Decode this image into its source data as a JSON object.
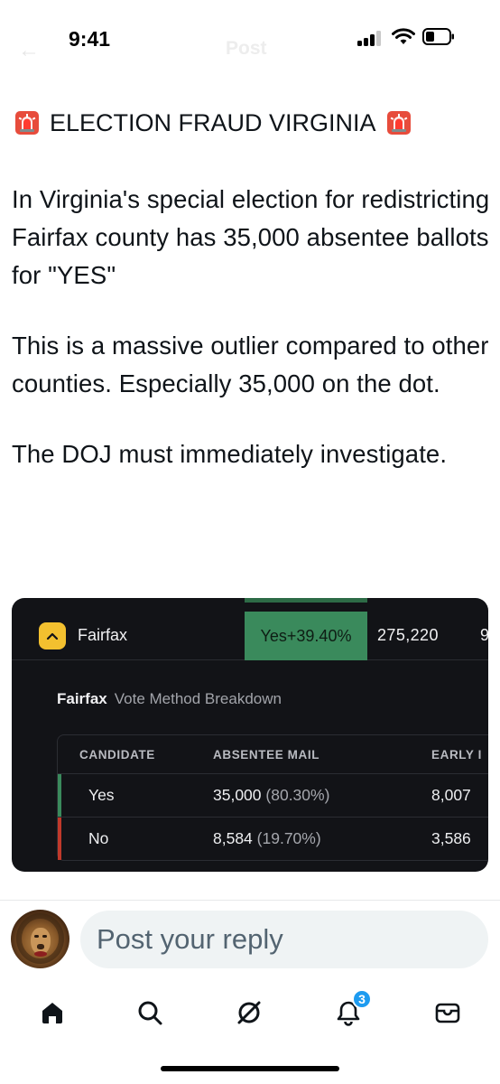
{
  "status_bar": {
    "time": "9:41",
    "ghost_title": "Post",
    "icons": [
      "back-arrow-icon",
      "cellular-signal-icon",
      "wifi-icon",
      "battery-icon"
    ]
  },
  "post": {
    "title": "ELECTION FRAUD VIRGINIA",
    "title_icon": "police-siren-emoji",
    "paragraphs": [
      "In Virginia's special election for redistricting Fairfax county has 35,000 absentee ballots for \"YES\"",
      "This is a massive outlier compared to other counties. Especially  35,000 on the dot.",
      "The DOJ must immediately investigate."
    ]
  },
  "embed": {
    "county_row": {
      "county": "Fairfax",
      "result": "Yes+39.40%",
      "total": "275,220",
      "total_cut": "9",
      "expand_icon": "chevron-up-icon"
    },
    "breakdown": {
      "county": "Fairfax",
      "label": "Vote Method Breakdown"
    },
    "table": {
      "headers": [
        "CANDIDATE",
        "ABSENTEE MAIL",
        "EARLY I"
      ],
      "rows": [
        {
          "candidate": "Yes",
          "absentee": "35,000",
          "absentee_pct": "(80.30%)",
          "early": "8,007",
          "color": "#3a8a5c"
        },
        {
          "candidate": "No",
          "absentee": "8,584",
          "absentee_pct": "(19.70%)",
          "early": "3,586",
          "color": "#c0392b"
        }
      ]
    }
  },
  "reply": {
    "placeholder": "Post your reply",
    "avatar": "lion-avatar"
  },
  "nav": {
    "items": [
      "home-icon",
      "search-icon",
      "grok-icon",
      "notifications-icon",
      "messages-icon"
    ],
    "notification_count": "3"
  },
  "colors": {
    "accent": "#1d9bf0",
    "yes_green": "#3a8a5c",
    "no_red": "#c0392b",
    "embed_bg": "#121317"
  }
}
